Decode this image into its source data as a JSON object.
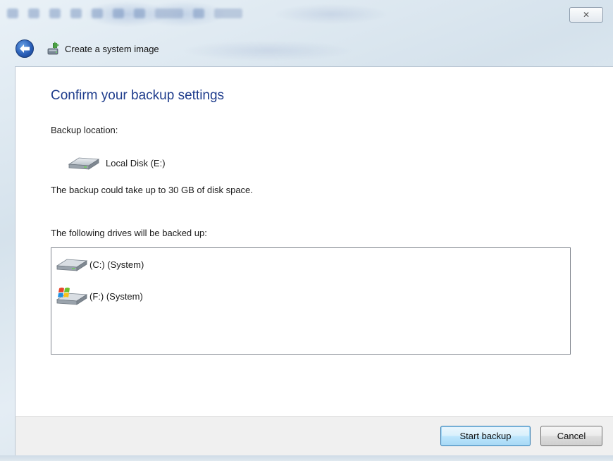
{
  "window": {
    "title": "Create a system image",
    "close_glyph": "✕"
  },
  "content": {
    "heading": "Confirm your backup settings",
    "backup_location_label": "Backup location:",
    "backup_location": {
      "icon": "hard-drive-icon",
      "name": "Local Disk (E:)"
    },
    "space_note": "The backup could take up to 30 GB of disk space.",
    "drives_label": "The following drives will be backed up:",
    "drives": [
      {
        "icon": "hard-drive-icon",
        "name": "(C:) (System)"
      },
      {
        "icon": "windows-drive-icon",
        "name": "(F:) (System)"
      }
    ]
  },
  "buttons": {
    "start": "Start backup",
    "cancel": "Cancel"
  },
  "colors": {
    "heading": "#1e3c8c",
    "accent_button_border": "#3c7fb1"
  }
}
